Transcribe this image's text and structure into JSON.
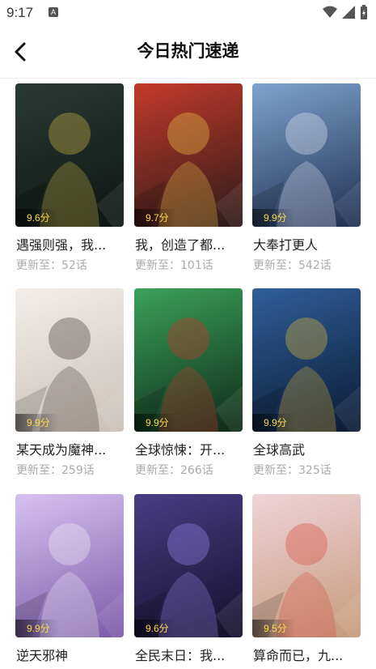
{
  "status_bar": {
    "time": "9:17",
    "notif_letter": "A"
  },
  "header": {
    "title": "今日热门速递"
  },
  "comics": [
    {
      "title": "遇强则强，我...",
      "score": "9.6分",
      "update": "更新至：52话",
      "bg": [
        "#2b3a34",
        "#0e1512"
      ],
      "accent": "#d9c24a"
    },
    {
      "title": "我，创造了都...",
      "score": "9.7分",
      "update": "更新至：101话",
      "bg": [
        "#c43a2a",
        "#2c1a1a"
      ],
      "accent": "#f3d04b"
    },
    {
      "title": "大奉打更人",
      "score": "9.9分",
      "update": "更新至：542话",
      "bg": [
        "#7fa3cf",
        "#1f3050"
      ],
      "accent": "#e9eef7"
    },
    {
      "title": "某天成为魔神...",
      "score": "9.9分",
      "update": "更新至：259话",
      "bg": [
        "#f3eeea",
        "#c9c0b8"
      ],
      "accent": "#3a2f2a"
    },
    {
      "title": "全球惊悚：开...",
      "score": "9.9分",
      "update": "更新至：266话",
      "bg": [
        "#3aa25a",
        "#0f2a18"
      ],
      "accent": "#d8322b"
    },
    {
      "title": "全球高武",
      "score": "9.9分",
      "update": "更新至：325话",
      "bg": [
        "#2f5f9a",
        "#0b1a33"
      ],
      "accent": "#f0c035"
    },
    {
      "title": "逆天邪神",
      "score": "9.9分",
      "update": "",
      "bg": [
        "#d6c2f0",
        "#7a5aa8"
      ],
      "accent": "#f6f3f8"
    },
    {
      "title": "全民末日：我...",
      "score": "9.6分",
      "update": "",
      "bg": [
        "#4a3d86",
        "#140f2a"
      ],
      "accent": "#9f8ff5"
    },
    {
      "title": "算命而已，九...",
      "score": "9.5分",
      "update": "",
      "bg": [
        "#efd3d8",
        "#c59a7a"
      ],
      "accent": "#d7463a"
    }
  ]
}
